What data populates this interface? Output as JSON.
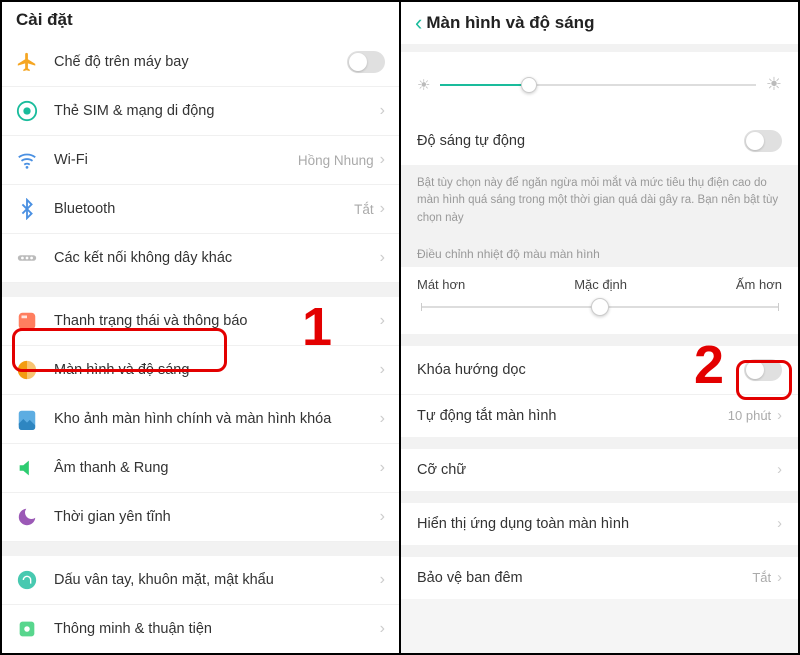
{
  "left": {
    "title": "Cài đặt",
    "items": [
      {
        "id": "airplane",
        "label": "Chế độ trên máy bay",
        "value": "",
        "type": "toggle",
        "icon": "airplane"
      },
      {
        "id": "sim",
        "label": "Thẻ SIM & mạng di động",
        "value": "",
        "type": "chev",
        "icon": "sim"
      },
      {
        "id": "wifi",
        "label": "Wi-Fi",
        "value": "Hồng Nhung",
        "type": "chev",
        "icon": "wifi"
      },
      {
        "id": "bluetooth",
        "label": "Bluetooth",
        "value": "Tắt",
        "type": "chev",
        "icon": "bt"
      },
      {
        "id": "wireless",
        "label": "Các kết nối không dây khác",
        "value": "",
        "type": "chev",
        "icon": "more"
      }
    ],
    "items2": [
      {
        "id": "status",
        "label": "Thanh trạng thái và thông báo",
        "icon": "status"
      },
      {
        "id": "display",
        "label": "Màn hình và độ sáng",
        "icon": "display"
      },
      {
        "id": "wallpaper",
        "label": "Kho ảnh màn hình chính và màn hình khóa",
        "icon": "wall"
      },
      {
        "id": "sound",
        "label": "Âm thanh & Rung",
        "icon": "sound"
      },
      {
        "id": "quiet",
        "label": "Thời gian yên tĩnh",
        "icon": "moon"
      }
    ],
    "items3": [
      {
        "id": "biometric",
        "label": "Dấu vân tay, khuôn mặt, mật khẩu",
        "icon": "finger"
      },
      {
        "id": "convenient",
        "label": "Thông minh & thuận tiện",
        "icon": "smart"
      }
    ],
    "annotation": "1"
  },
  "right": {
    "title": "Màn hình và độ sáng",
    "auto_brightness": "Độ sáng tự động",
    "auto_desc": "Bật tùy chọn này để ngăn ngừa mỏi mắt và mức tiêu thụ điện cao do màn hình quá sáng trong một thời gian quá dài gây ra. Bạn nên bật tùy chọn này",
    "temp_header": "Điều chỉnh nhiệt độ màu màn hình",
    "temp_cool": "Mát hơn",
    "temp_default": "Mặc định",
    "temp_warm": "Ấm hơn",
    "lock_rotation": "Khóa hướng dọc",
    "auto_off": "Tự động tắt màn hình",
    "auto_off_val": "10 phút",
    "font_size": "Cỡ chữ",
    "fullscreen": "Hiển thị ứng dụng toàn màn hình",
    "night": "Bảo vệ ban đêm",
    "night_val": "Tắt",
    "annotation": "2"
  }
}
